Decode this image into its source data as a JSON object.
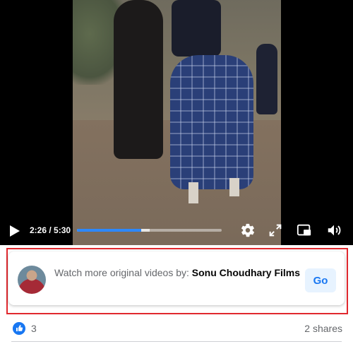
{
  "player": {
    "current_time": "2:26",
    "duration": "5:30",
    "time_separator": " / ",
    "progress_fraction": 0.4424,
    "buffered_fraction": 0.5,
    "accent_color": "#2d88ff",
    "icons": [
      "play-icon",
      "settings-gear-icon",
      "fullscreen-icon",
      "picture-in-picture-icon",
      "volume-icon"
    ]
  },
  "promo": {
    "prefix": "Watch more original videos by:",
    "page_name": "Sonu Choudhary Films",
    "go_label": "Go",
    "highlight_color": "#e0282e"
  },
  "footer": {
    "like_count": "3",
    "shares": "2 shares",
    "like_color": "#1877f2"
  }
}
